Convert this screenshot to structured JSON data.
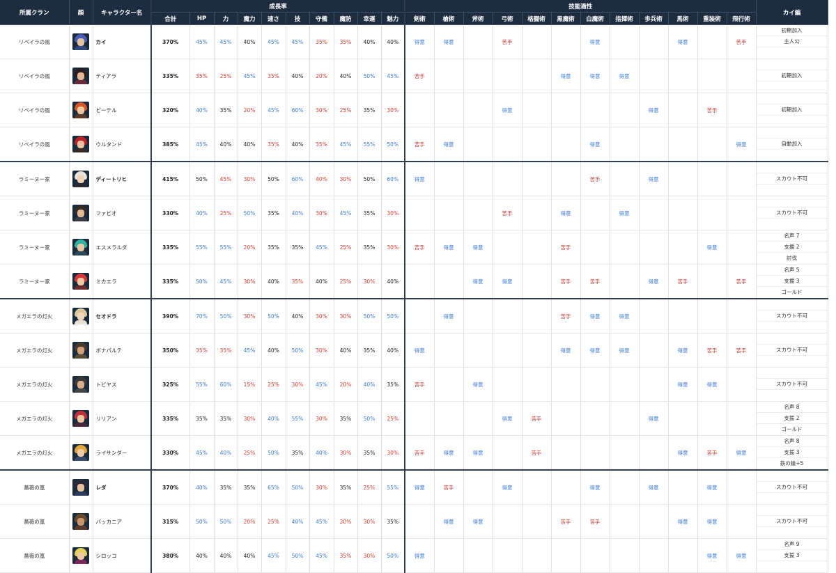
{
  "headers": {
    "clan": "所属クラン",
    "face": "顔",
    "name": "キャラクター名",
    "growth_group": "成長率",
    "skill_group": "技能適性",
    "notes": "カイ編",
    "stats": [
      "合計",
      "HP",
      "力",
      "魔力",
      "速さ",
      "技",
      "守備",
      "魔防",
      "幸運",
      "魅力"
    ],
    "skills": [
      "剣術",
      "槍術",
      "斧術",
      "弓術",
      "格闘術",
      "黒魔術",
      "白魔術",
      "指揮術",
      "歩兵術",
      "馬術",
      "重装術",
      "飛行術"
    ]
  },
  "legend_colors": {
    "high": "#3d7bd6",
    "low": "#de3b30",
    "header_bg": "#1d2d3f"
  },
  "characters": [
    {
      "clan": "リベイラの風",
      "name": "カイ",
      "bold": true,
      "total": "370%",
      "stats": [
        "45%",
        "45%",
        "40%",
        "45%",
        "45%",
        "35%",
        "35%",
        "40%",
        "40%"
      ],
      "hl": [
        "h",
        "h",
        "",
        "h",
        "h",
        "l",
        "l",
        "",
        ""
      ],
      "skills": [
        "得意",
        "得意",
        "",
        "苦手",
        "",
        "",
        "得意",
        "",
        "",
        "得意",
        "",
        "苦手"
      ],
      "notes": [
        "初期加入",
        "主人公",
        ""
      ],
      "face": {
        "hair": "#4b5bb8",
        "skin": "#e8c39f",
        "body": "#2f4a7a"
      }
    },
    {
      "clan": "リベイラの風",
      "name": "ティアラ",
      "bold": false,
      "total": "335%",
      "stats": [
        "35%",
        "25%",
        "45%",
        "35%",
        "40%",
        "20%",
        "40%",
        "50%",
        "45%"
      ],
      "hl": [
        "l",
        "l",
        "h",
        "l",
        "",
        "l",
        "",
        "h",
        "h"
      ],
      "skills": [
        "苦手",
        "",
        "",
        "",
        "",
        "得意",
        "得意",
        "得意",
        "",
        "",
        "",
        ""
      ],
      "notes": [
        "",
        "初期加入",
        ""
      ],
      "face": {
        "hair": "#2a1e1e",
        "skin": "#e3b894",
        "body": "#6b2b3a"
      }
    },
    {
      "clan": "リベイラの風",
      "name": "ピーテル",
      "bold": false,
      "total": "320%",
      "stats": [
        "40%",
        "35%",
        "20%",
        "45%",
        "60%",
        "30%",
        "25%",
        "35%",
        "30%"
      ],
      "hl": [
        "h",
        "",
        "l",
        "h",
        "h",
        "l",
        "l",
        "",
        "l"
      ],
      "skills": [
        "",
        "",
        "",
        "得意",
        "",
        "",
        "",
        "",
        "得意",
        "",
        "苦手",
        ""
      ],
      "notes": [
        "",
        "初期加入",
        ""
      ],
      "face": {
        "hair": "#d4582c",
        "skin": "#efc9a6",
        "body": "#5a3a2a"
      }
    },
    {
      "clan": "リベイラの風",
      "name": "ウルタンド",
      "bold": false,
      "total": "385%",
      "stats": [
        "45%",
        "40%",
        "40%",
        "35%",
        "40%",
        "35%",
        "45%",
        "55%",
        "50%"
      ],
      "hl": [
        "h",
        "",
        "",
        "l",
        "",
        "l",
        "h",
        "h",
        "h"
      ],
      "skills": [
        "苦手",
        "得意",
        "",
        "",
        "",
        "",
        "得意",
        "",
        "",
        "",
        "",
        "得意"
      ],
      "notes": [
        "",
        "自動加入",
        ""
      ],
      "face": {
        "hair": "#b8232b",
        "skin": "#e8c0a0",
        "body": "#3a2a2a"
      },
      "end": true
    },
    {
      "clan": "ラミーヌー家",
      "name": "ディートリヒ",
      "bold": true,
      "total": "415%",
      "stats": [
        "50%",
        "45%",
        "30%",
        "50%",
        "60%",
        "40%",
        "30%",
        "50%",
        "60%"
      ],
      "hl": [
        "",
        "l",
        "l",
        "",
        "h",
        "l",
        "l",
        "",
        "h"
      ],
      "skills": [
        "得意",
        "",
        "",
        "",
        "",
        "",
        "苦手",
        "",
        "得意",
        "",
        "",
        ""
      ],
      "notes": [
        "",
        "スカウト不可",
        ""
      ],
      "face": {
        "hair": "#e8e4dc",
        "skin": "#f0d2b4",
        "body": "#2b2b33"
      }
    },
    {
      "clan": "ラミーヌー家",
      "name": "ファビオ",
      "bold": false,
      "total": "330%",
      "stats": [
        "40%",
        "25%",
        "50%",
        "35%",
        "40%",
        "30%",
        "45%",
        "35%",
        "30%"
      ],
      "hl": [
        "h",
        "l",
        "h",
        "",
        "h",
        "l",
        "h",
        "",
        "l"
      ],
      "skills": [
        "",
        "",
        "",
        "苦手",
        "",
        "得意",
        "",
        "得意",
        "",
        "",
        "",
        ""
      ],
      "notes": [
        "",
        "スカウト不可",
        ""
      ],
      "face": {
        "hair": "#3a2a24",
        "skin": "#e2bb98",
        "body": "#3c3c44"
      }
    },
    {
      "clan": "ラミーヌー家",
      "name": "エスメラルダ",
      "bold": false,
      "total": "335%",
      "stats": [
        "55%",
        "55%",
        "20%",
        "35%",
        "35%",
        "45%",
        "25%",
        "35%",
        "30%"
      ],
      "hl": [
        "h",
        "h",
        "l",
        "",
        "",
        "h",
        "l",
        "",
        "l"
      ],
      "skills": [
        "苦手",
        "得意",
        "得意",
        "",
        "",
        "苦手",
        "",
        "",
        "",
        "",
        "得意",
        ""
      ],
      "notes": [
        "名声 7",
        "支援 2",
        "討伐"
      ],
      "face": {
        "hair": "#2fb0a0",
        "skin": "#eac6a4",
        "body": "#2a4a5a"
      }
    },
    {
      "clan": "ラミーヌー家",
      "name": "ミカエラ",
      "bold": false,
      "total": "335%",
      "stats": [
        "50%",
        "45%",
        "30%",
        "40%",
        "35%",
        "40%",
        "25%",
        "30%",
        "40%"
      ],
      "hl": [
        "h",
        "h",
        "l",
        "",
        "l",
        "",
        "l",
        "l",
        ""
      ],
      "skills": [
        "",
        "",
        "得意",
        "得意",
        "",
        "苦手",
        "苦手",
        "",
        "得意",
        "苦手",
        "",
        "苦手"
      ],
      "notes": [
        "名声 5",
        "支援 3",
        "ゴールド"
      ],
      "face": {
        "hair": "#d8383a",
        "skin": "#edc7a5",
        "body": "#6a2a2a"
      },
      "end": true
    },
    {
      "clan": "メガエラの灯火",
      "name": "セオドラ",
      "bold": true,
      "total": "390%",
      "stats": [
        "70%",
        "50%",
        "30%",
        "50%",
        "40%",
        "30%",
        "30%",
        "50%",
        "50%"
      ],
      "hl": [
        "h",
        "h",
        "l",
        "h",
        "",
        "l",
        "l",
        "h",
        "h"
      ],
      "skills": [
        "",
        "得意",
        "",
        "",
        "",
        "苦手",
        "得意",
        "得意",
        "",
        "",
        "",
        ""
      ],
      "notes": [
        "",
        "スカウト不可",
        ""
      ],
      "face": {
        "hair": "#d9c69a",
        "skin": "#f1d6b8",
        "body": "#e6e0d0"
      }
    },
    {
      "clan": "メガエラの灯火",
      "name": "ボナパルテ",
      "bold": false,
      "total": "350%",
      "stats": [
        "35%",
        "35%",
        "45%",
        "40%",
        "50%",
        "30%",
        "40%",
        "35%",
        "40%"
      ],
      "hl": [
        "l",
        "l",
        "h",
        "",
        "h",
        "l",
        "",
        "",
        ""
      ],
      "skills": [
        "得意",
        "",
        "",
        "",
        "",
        "得意",
        "得意",
        "得意",
        "",
        "得意",
        "苦手",
        "苦手"
      ],
      "notes": [
        "",
        "スカウト不可",
        ""
      ],
      "face": {
        "hair": "#4a3a30",
        "skin": "#cfa07a",
        "body": "#5a4a3a"
      }
    },
    {
      "clan": "メガエラの灯火",
      "name": "トビヤス",
      "bold": false,
      "total": "325%",
      "stats": [
        "55%",
        "60%",
        "15%",
        "25%",
        "30%",
        "45%",
        "20%",
        "40%",
        "35%"
      ],
      "hl": [
        "h",
        "h",
        "l",
        "l",
        "l",
        "h",
        "l",
        "h",
        ""
      ],
      "skills": [
        "苦手",
        "",
        "得意",
        "",
        "",
        "",
        "",
        "",
        "",
        "得意",
        "得意",
        ""
      ],
      "notes": [
        "",
        "スカウト不可",
        ""
      ],
      "face": {
        "hair": "#3a3a3a",
        "skin": "#d9b08c",
        "body": "#444444"
      }
    },
    {
      "clan": "メガエラの灯火",
      "name": "リリアン",
      "bold": false,
      "total": "335%",
      "stats": [
        "35%",
        "35%",
        "30%",
        "40%",
        "55%",
        "30%",
        "35%",
        "50%",
        "25%"
      ],
      "hl": [
        "",
        "",
        "l",
        "h",
        "h",
        "l",
        "",
        "h",
        "l"
      ],
      "skills": [
        "",
        "",
        "",
        "得意",
        "苦手",
        "",
        "",
        "",
        "得意",
        "",
        "",
        ""
      ],
      "notes": [
        "名声 8",
        "支援 2",
        "ゴールド"
      ],
      "face": {
        "hair": "#c0303a",
        "skin": "#ecc4a2",
        "body": "#4a2a3a"
      }
    },
    {
      "clan": "メガエラの灯火",
      "name": "ライサンダー",
      "bold": false,
      "total": "330%",
      "stats": [
        "45%",
        "40%",
        "25%",
        "50%",
        "35%",
        "40%",
        "30%",
        "35%",
        "30%"
      ],
      "hl": [
        "h",
        "h",
        "l",
        "h",
        "",
        "h",
        "l",
        "",
        "l"
      ],
      "skills": [
        "苦手",
        "得意",
        "得意",
        "",
        "苦手",
        "",
        "",
        "",
        "",
        "得意",
        "苦手",
        "得意"
      ],
      "notes": [
        "名声 8",
        "支援 3",
        "鉄の槍+5"
      ],
      "face": {
        "hair": "#e0a53a",
        "skin": "#efcca8",
        "body": "#3a4a6a"
      },
      "end": true
    },
    {
      "clan": "薔薇の嵐",
      "name": "レダ",
      "bold": true,
      "total": "370%",
      "stats": [
        "40%",
        "35%",
        "35%",
        "65%",
        "50%",
        "30%",
        "35%",
        "25%",
        "55%"
      ],
      "hl": [
        "h",
        "",
        "",
        "h",
        "h",
        "l",
        "",
        "l",
        "h"
      ],
      "skills": [
        "得意",
        "苦手",
        "",
        "得意",
        "",
        "",
        "得意",
        "",
        "得意",
        "",
        "得意",
        ""
      ],
      "notes": [
        "",
        "スカウト不可",
        ""
      ],
      "face": {
        "hair": "#2a2a38",
        "skin": "#e6bf9c",
        "body": "#2a3a5a"
      }
    },
    {
      "clan": "薔薇の嵐",
      "name": "バッカニア",
      "bold": false,
      "total": "315%",
      "stats": [
        "50%",
        "50%",
        "20%",
        "25%",
        "40%",
        "45%",
        "20%",
        "30%",
        "35%"
      ],
      "hl": [
        "h",
        "h",
        "l",
        "l",
        "h",
        "h",
        "l",
        "l",
        ""
      ],
      "skills": [
        "",
        "得意",
        "得意",
        "",
        "",
        "苦手",
        "苦手",
        "",
        "",
        "得意",
        "得意",
        ""
      ],
      "notes": [
        "",
        "スカウト不可",
        ""
      ],
      "face": {
        "hair": "#6a4a2a",
        "skin": "#c9976e",
        "body": "#5a3a2a"
      }
    },
    {
      "clan": "薔薇の嵐",
      "name": "シロッコ",
      "bold": false,
      "total": "380%",
      "stats": [
        "40%",
        "40%",
        "40%",
        "45%",
        "50%",
        "45%",
        "35%",
        "30%",
        "50%"
      ],
      "hl": [
        "",
        "",
        "",
        "h",
        "h",
        "h",
        "l",
        "l",
        "h"
      ],
      "skills": [
        "得意",
        "",
        "",
        "",
        "",
        "",
        "",
        "",
        "",
        "",
        "得意",
        "得意"
      ],
      "notes": [
        "名声 9",
        "支援 3",
        ""
      ],
      "face": {
        "hair": "#e3d25a",
        "skin": "#eecaa6",
        "body": "#7a2a5a"
      }
    }
  ]
}
